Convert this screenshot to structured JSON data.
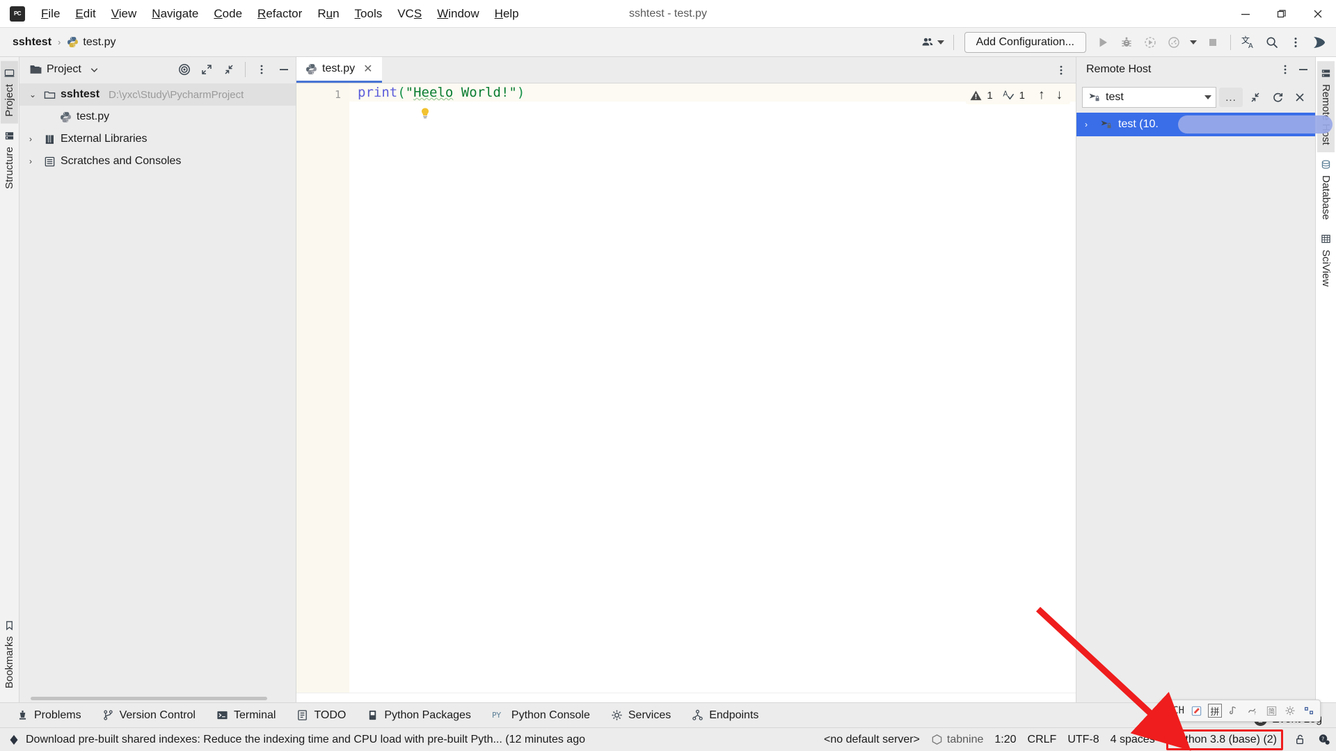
{
  "window": {
    "title": "sshtest - test.py",
    "app_logo": "pycharm-logo",
    "minimize": "─",
    "maximize": "❐",
    "close": "✕"
  },
  "menubar": {
    "items": [
      {
        "label": "File",
        "mnemonic": "F"
      },
      {
        "label": "Edit",
        "mnemonic": "E"
      },
      {
        "label": "View",
        "mnemonic": "V"
      },
      {
        "label": "Navigate",
        "mnemonic": "N"
      },
      {
        "label": "Code",
        "mnemonic": "C"
      },
      {
        "label": "Refactor",
        "mnemonic": "R"
      },
      {
        "label": "Run",
        "mnemonic": "u"
      },
      {
        "label": "Tools",
        "mnemonic": "T"
      },
      {
        "label": "VCS",
        "mnemonic": "S"
      },
      {
        "label": "Window",
        "mnemonic": "W"
      },
      {
        "label": "Help",
        "mnemonic": "H"
      }
    ]
  },
  "navbar": {
    "breadcrumb": [
      {
        "label": "sshtest",
        "icon": "none"
      },
      {
        "label": "test.py",
        "icon": "python-file-icon"
      }
    ],
    "separator": "›",
    "add_configuration": "Add Configuration...",
    "icons": [
      "collaborate-icon",
      "run-icon",
      "debug-icon",
      "run-coverage-icon",
      "profile-icon",
      "stop-icon",
      "translate-icon",
      "search-everywhere-icon",
      "more-options-icon",
      "feedback-icon"
    ]
  },
  "left_strip": {
    "tabs": [
      {
        "label": "Project",
        "icon": "project-icon",
        "active": true
      },
      {
        "label": "Structure",
        "icon": "structure-icon",
        "active": false
      }
    ],
    "bottom_tabs": [
      {
        "label": "Bookmarks",
        "icon": "bookmarks-icon",
        "active": false
      }
    ]
  },
  "project_panel": {
    "title": "Project",
    "header_icons": [
      "target-icon",
      "expand-all-icon",
      "collapse-all-icon",
      "more-options-icon",
      "hide-icon"
    ],
    "tree": [
      {
        "label": "sshtest",
        "path": "D:\\yxc\\Study\\PycharmProject",
        "icon": "folder-icon",
        "twisty": "⌄",
        "depth": 0,
        "bold": true,
        "selected": true
      },
      {
        "label": "test.py",
        "path": "",
        "icon": "python-file-icon",
        "twisty": "",
        "depth": 1,
        "bold": false,
        "selected": false
      },
      {
        "label": "External Libraries",
        "path": "",
        "icon": "library-icon",
        "twisty": "›",
        "depth": 0,
        "bold": false,
        "selected": false
      },
      {
        "label": "Scratches and Consoles",
        "path": "",
        "icon": "scratches-icon",
        "twisty": "›",
        "depth": 0,
        "bold": false,
        "selected": false
      }
    ]
  },
  "editor": {
    "tabs": [
      {
        "label": "test.py",
        "icon": "python-file-icon",
        "close": "✕",
        "active": true
      }
    ],
    "tab_more_icon": "more-options-icon",
    "line_numbers": [
      "1"
    ],
    "code": {
      "func": "print",
      "open_paren": "(",
      "string_open": "\"",
      "string_word1": "Heelo",
      "string_space": " ",
      "string_word2": "World!",
      "string_close": "\"",
      "close_paren": ")"
    },
    "intention_icon": "lightbulb-icon",
    "inspections": {
      "warning_icon": "warning-icon",
      "warning_count": "1",
      "spellcheck_icon": "spellcheck-icon",
      "spellcheck_count": "1",
      "prev_icon": "↑",
      "next_icon": "↓"
    }
  },
  "remote_host": {
    "title": "Remote Host",
    "header_icons": [
      "more-options-icon",
      "hide-icon"
    ],
    "connection": {
      "icon": "sftp-connection-icon",
      "value": "test",
      "dropdown_icon": "chevron-down-icon"
    },
    "toolbar_icons": [
      "browse-dots-button",
      "collapse-all-icon",
      "refresh-icon",
      "close-icon"
    ],
    "browse_label": "...",
    "tree": [
      {
        "twisty": "›",
        "icon": "sftp-connection-icon",
        "label": "test (10.",
        "redacted": true,
        "selected": true
      }
    ]
  },
  "right_strip": {
    "tabs": [
      {
        "label": "Remote Host",
        "icon": "remote-host-icon",
        "active": true
      },
      {
        "label": "Database",
        "icon": "database-icon",
        "active": false
      },
      {
        "label": "SciView",
        "icon": "sciview-icon",
        "active": false
      }
    ]
  },
  "tool_windows": {
    "items": [
      {
        "label": "Problems",
        "icon": "problems-icon"
      },
      {
        "label": "Version Control",
        "icon": "version-control-icon"
      },
      {
        "label": "Terminal",
        "icon": "terminal-icon"
      },
      {
        "label": "TODO",
        "icon": "todo-icon"
      },
      {
        "label": "Python Packages",
        "icon": "python-packages-icon"
      },
      {
        "label": "Python Console",
        "icon": "python-console-icon"
      },
      {
        "label": "Services",
        "icon": "services-icon"
      },
      {
        "label": "Endpoints",
        "icon": "endpoints-icon"
      }
    ]
  },
  "statusbar": {
    "notification_icon": "ide-notification-icon",
    "message": "Download pre-built shared indexes: Reduce the indexing time and CPU load with pre-built Pyth... (12 minutes ago",
    "server": "<no default server>",
    "tabnine": "tabnine",
    "tabnine_icon": "tabnine-icon",
    "caret": "1:20",
    "line_separator": "CRLF",
    "encoding": "UTF-8",
    "indent": "4 spaces",
    "interpreter": "Python 3.8 (base) (2)",
    "interpreter_highlight_color": "#ef1d1d",
    "lock_icon": "unlocked-icon",
    "inspection_icon": "inspection-level-icon"
  },
  "event_log": {
    "label": "Event Log",
    "count": "2"
  },
  "ime_widget": {
    "mode": "CH",
    "items": [
      "pen-icon",
      "pinyin-icon",
      "voice-icon",
      "handwriting-icon",
      "simplified-icon",
      "settings-icon",
      "keyboard-icon"
    ],
    "pinyin_label": "拼",
    "simplified_label": "简"
  },
  "annotation": {
    "arrow_color": "#ef1d1d",
    "points_to": "interpreter"
  },
  "colors": {
    "accent": "#3a6ee8",
    "tab_underline": "#4874d4",
    "panel_bg": "#ececec",
    "editor_line_bg": "#fcfaf2",
    "gutter_bg": "#fbf8ef",
    "string_green": "#0a7d32",
    "keyword_blue": "#5c5cdb"
  }
}
